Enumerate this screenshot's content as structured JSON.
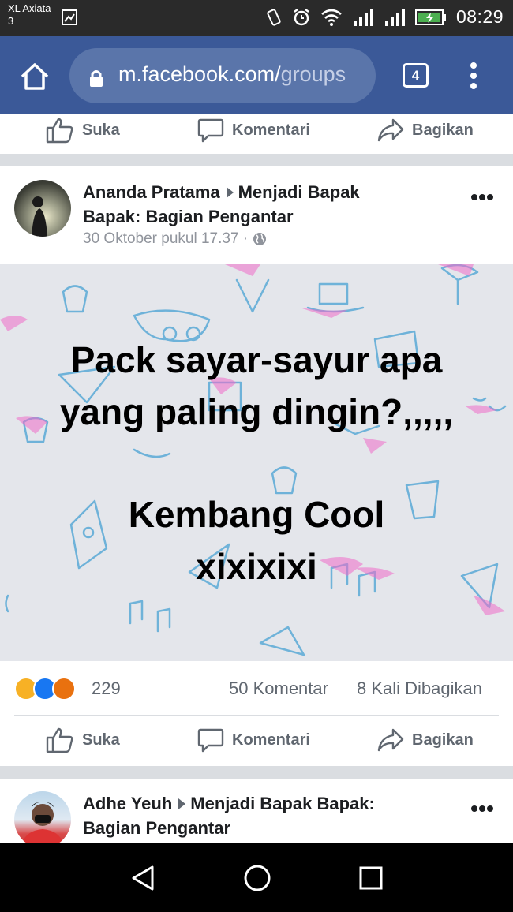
{
  "status_bar": {
    "carrier_line1": "XL Axiata",
    "carrier_line2": "3",
    "time": "08:29"
  },
  "browser": {
    "url_main": "m.facebook.com/",
    "url_path": "groups",
    "tab_count": "4"
  },
  "actions": {
    "like": "Suka",
    "comment": "Komentari",
    "share": "Bagikan"
  },
  "post": {
    "author": "Ananda Pratama",
    "group_line1": "Menjadi Bapak",
    "group_line2": "Bapak: Bagian Pengantar",
    "timestamp": "30 Oktober pukul 17.37 ·",
    "text_line1": "Pack sayar-sayur apa",
    "text_line2": "yang paling dingin?,,,,,",
    "text_line3": "Kembang Cool",
    "text_line4": "xixixixi",
    "reaction_count": "229",
    "comment_count": "50 Komentar",
    "share_count": "8 Kali Dibagikan"
  },
  "next_post": {
    "author": "Adhe Yeuh",
    "group_line1": "Menjadi Bapak Bapak:",
    "group_line2": "Bagian Pengantar"
  },
  "colors": {
    "facebook_blue": "#3b5998",
    "reaction_haha": "#f7b125",
    "reaction_like": "#1877f2",
    "reaction_angry": "#e9710f"
  }
}
